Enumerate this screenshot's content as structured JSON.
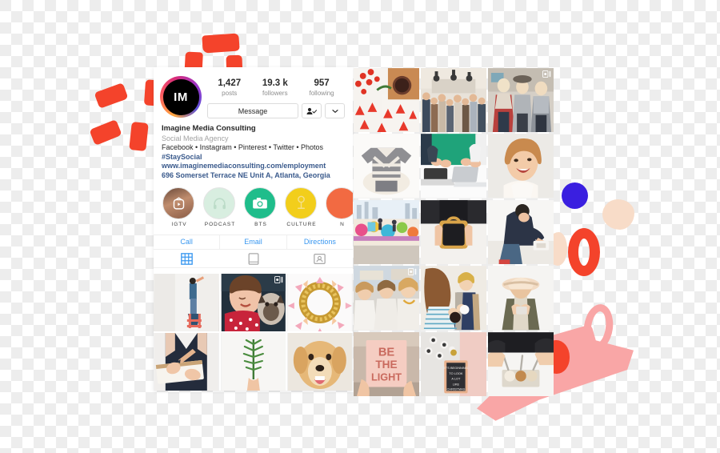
{
  "profile": {
    "avatar_initials": "IM",
    "stats": [
      {
        "num": "1,427",
        "label": "posts"
      },
      {
        "num": "19.3 k",
        "label": "followers"
      },
      {
        "num": "957",
        "label": "following"
      }
    ],
    "message_button": "Message",
    "follow_icon": "person-check-icon",
    "more_icon": "chevron-down-icon",
    "name": "Imagine Media Consulting",
    "category": "Social Media Agency",
    "description": "Facebook • Instagram • Pinterest • Twitter • Photos",
    "hashtag": "#StaySocial",
    "website": "www.imaginemediaconsulting.com/employment",
    "address": "696 Somerset Terrace NE Unit A, Atlanta, Georgia"
  },
  "highlights": [
    {
      "label": "IGTV",
      "style": "hl-igtv",
      "icon": "igtv-icon"
    },
    {
      "label": "PODCAST",
      "style": "hl-pod",
      "icon": "headphones-icon"
    },
    {
      "label": "BTS",
      "style": "hl-bts",
      "icon": "camera-icon"
    },
    {
      "label": "CULTURE",
      "style": "hl-cul",
      "icon": "trophy-icon"
    },
    {
      "label": "N",
      "style": "hl-ne",
      "icon": "none"
    }
  ],
  "cta": [
    {
      "label": "Call"
    },
    {
      "label": "Email"
    },
    {
      "label": "Directions"
    }
  ],
  "tabs": [
    {
      "name": "grid-tab",
      "icon": "grid-icon",
      "active": true
    },
    {
      "name": "igtv-tab",
      "icon": "tv-icon",
      "active": false
    },
    {
      "name": "tagged-tab",
      "icon": "tagged-icon",
      "active": false
    }
  ],
  "colors": {
    "accent_blue": "#3897f0",
    "link_navy": "#3a5a8c",
    "brush_red": "#F4432B",
    "dot_blue": "#3A1FE0",
    "peach": "#F8DCC8",
    "pink": "#F9A6A6",
    "highlight_green": "#1FBD8B",
    "highlight_yellow": "#F2CE1B",
    "highlight_mint": "#D8EEE0",
    "highlight_orange": "#F26A42"
  },
  "left_grid": [
    {
      "alt": "person-painting-wall",
      "overlay": "none"
    },
    {
      "alt": "woman-holding-pug",
      "overlay": "carousel-icon"
    },
    {
      "alt": "gold-glitter-wreath",
      "overlay": "none"
    },
    {
      "alt": "person-writing-journal",
      "overlay": "none"
    },
    {
      "alt": "hand-holding-pine-sprig",
      "overlay": "none"
    },
    {
      "alt": "golden-retriever-dog",
      "overlay": "none"
    }
  ],
  "right_grid": [
    {
      "alt": "christmas-tree-blanket-coffee",
      "overlay": "none"
    },
    {
      "alt": "crowded-event-venue",
      "overlay": "none"
    },
    {
      "alt": "three-women-in-boutique",
      "overlay": "carousel-icon"
    },
    {
      "alt": "grey-striped-sweater-flatlay",
      "overlay": "none"
    },
    {
      "alt": "hands-typing-on-laptops",
      "overlay": "none"
    },
    {
      "alt": "laughing-woman-portrait",
      "overlay": "none"
    },
    {
      "alt": "colorful-mural-wall-street",
      "overlay": "none"
    },
    {
      "alt": "woman-holding-bunny-ears-bag",
      "overlay": "none"
    },
    {
      "alt": "man-bending-over-desk",
      "overlay": "none"
    },
    {
      "alt": "women-laughing-outdoors",
      "overlay": "carousel-icon"
    },
    {
      "alt": "two-women-with-drinks",
      "overlay": "none"
    },
    {
      "alt": "woman-in-hat-with-phone",
      "overlay": "none"
    },
    {
      "alt": "be-the-light-sign",
      "overlay": "none"
    },
    {
      "alt": "letterboard-christmas-quote",
      "overlay": "none"
    },
    {
      "alt": "hands-serving-desserts",
      "overlay": "none"
    }
  ]
}
